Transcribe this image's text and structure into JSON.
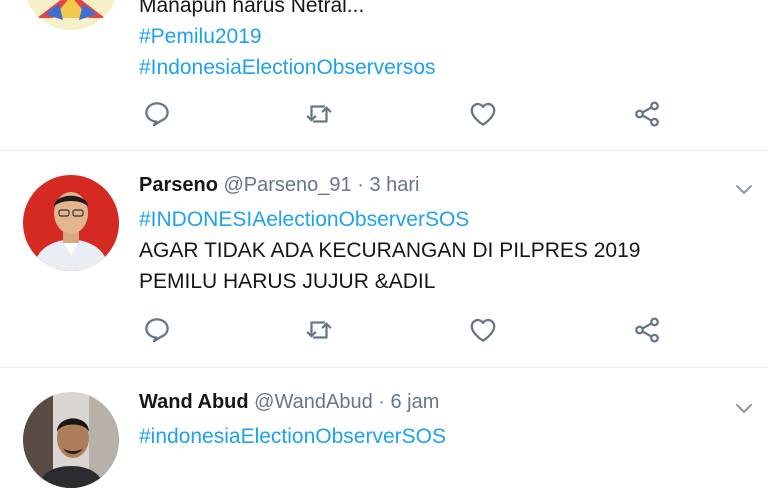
{
  "tweets": [
    {
      "lines": [
        "Manapun harus Netral..."
      ],
      "hashtags": [
        "#Pemilu2019",
        "#IndonesiaElectionObserversos"
      ]
    },
    {
      "name": "Parseno",
      "handle": "@Parseno_91",
      "time": "· 3 hari",
      "hashtag": "#INDONESIAelectionObserverSOS",
      "lines": [
        "AGAR TIDAK ADA KECURANGAN DI PILPRES 2019",
        "PEMILU HARUS JUJUR &ADIL"
      ]
    },
    {
      "name": "Wand Abud",
      "handle": "@WandAbud",
      "time": "· 6 jam",
      "hashtag": "#indonesiaElectionObserverSOS"
    }
  ],
  "icons": {
    "reply": "reply-icon",
    "retweet": "retweet-icon",
    "like": "heart-icon",
    "share": "share-icon",
    "more": "chevron-down-icon"
  },
  "colors": {
    "hashtag": "#1da1f2",
    "icon": "#657786",
    "divider": "#e6ecf0"
  }
}
